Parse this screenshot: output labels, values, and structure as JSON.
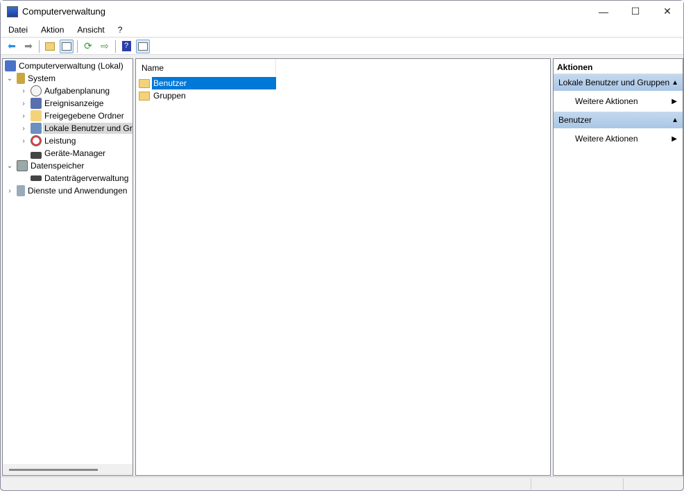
{
  "window": {
    "title": "Computerverwaltung",
    "minimize_icon": "minimize-icon",
    "maximize_icon": "maximize-icon",
    "close_icon": "close-icon"
  },
  "menu": [
    "Datei",
    "Aktion",
    "Ansicht",
    "?"
  ],
  "toolbar": [
    "back-arrow-icon",
    "forward-arrow-icon",
    "up-folder-icon",
    "show-hide-console-tree-icon",
    "refresh-icon",
    "export-list-icon",
    "help-icon",
    "show-hide-action-pane-icon"
  ],
  "tree": {
    "root": "Computerverwaltung (Lokal)",
    "system": "System",
    "system_children": [
      "Aufgabenplanung",
      "Ereignisanzeige",
      "Freigegebene Ordner",
      "Lokale Benutzer und Gruppen",
      "Leistung",
      "Geräte-Manager"
    ],
    "storage": "Datenspeicher",
    "storage_children": [
      "Datenträgerverwaltung"
    ],
    "services": "Dienste und Anwendungen",
    "selected": "Lokale Benutzer und Gruppen"
  },
  "list": {
    "column": "Name",
    "items": [
      "Benutzer",
      "Gruppen"
    ],
    "selected": "Benutzer"
  },
  "actions": {
    "title": "Aktionen",
    "groups": [
      {
        "label": "Lokale Benutzer und Gruppen",
        "item": "Weitere Aktionen"
      },
      {
        "label": "Benutzer",
        "item": "Weitere Aktionen"
      }
    ]
  },
  "colors": {
    "selection": "#0078d7",
    "action_group": "#b7cfea",
    "tree_selection": "#d9d9d9"
  }
}
